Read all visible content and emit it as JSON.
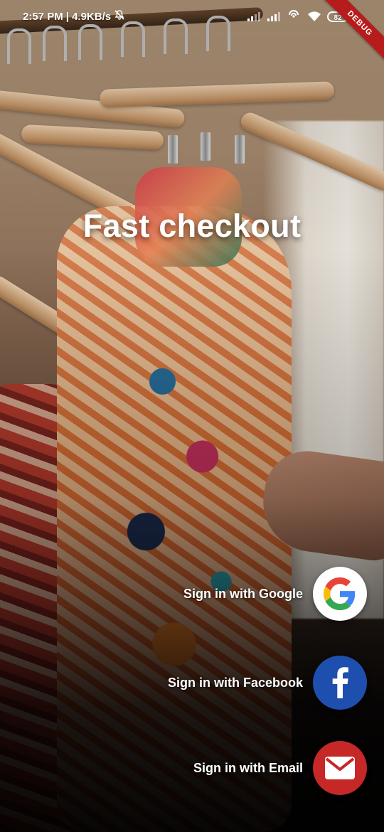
{
  "status_bar": {
    "time": "2:57 PM",
    "net_speed": "| 4.9KB/s",
    "battery": "82",
    "icons": [
      "mute-icon",
      "signal-icon",
      "signal-icon",
      "hotspot-icon",
      "wifi-icon",
      "battery-icon"
    ]
  },
  "debug_banner": "DEBUG",
  "title": "Fast checkout",
  "signin": {
    "google": {
      "label": "Sign in with Google",
      "icon": "google-icon",
      "color": "#ffffff"
    },
    "facebook": {
      "label": "Sign in with Facebook",
      "icon": "facebook-icon",
      "color": "#1f4fae"
    },
    "email": {
      "label": "Sign in with Email",
      "icon": "mail-icon",
      "color": "#c62828"
    }
  },
  "background": {
    "description_icon": "clothes-rack-photo"
  }
}
